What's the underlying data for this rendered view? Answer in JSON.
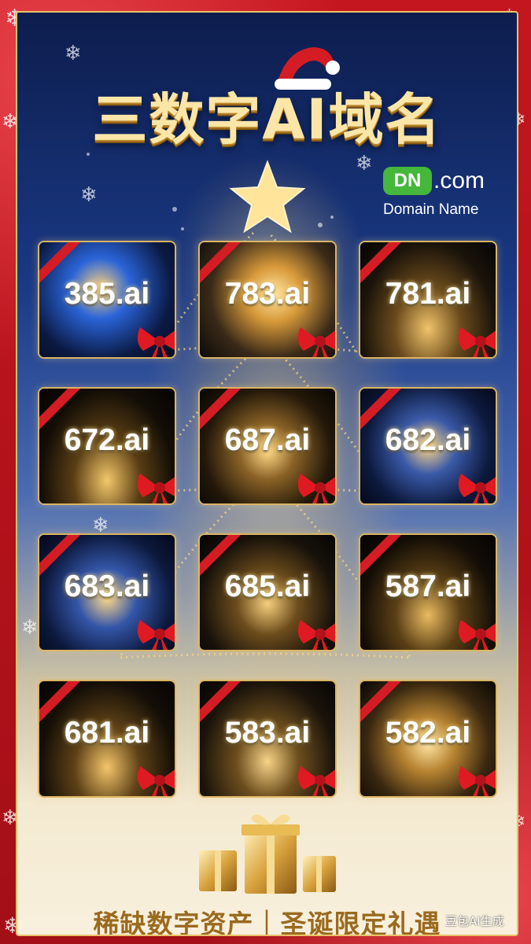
{
  "title": "三数字AI域名",
  "brand": {
    "badge": "DN",
    "domain": ".com",
    "subtitle": "Domain Name"
  },
  "domains": [
    "385.ai",
    "783.ai",
    "781.ai",
    "672.ai",
    "687.ai",
    "682.ai",
    "683.ai",
    "685.ai",
    "587.ai",
    "681.ai",
    "583.ai",
    "582.ai"
  ],
  "footer": "稀缺数字资产｜圣诞限定礼遇",
  "watermark": "豆包AI生成",
  "colors": {
    "accent_gold": "#e9c36a",
    "frame_red": "#b5121b",
    "brand_green": "#45b73a"
  }
}
